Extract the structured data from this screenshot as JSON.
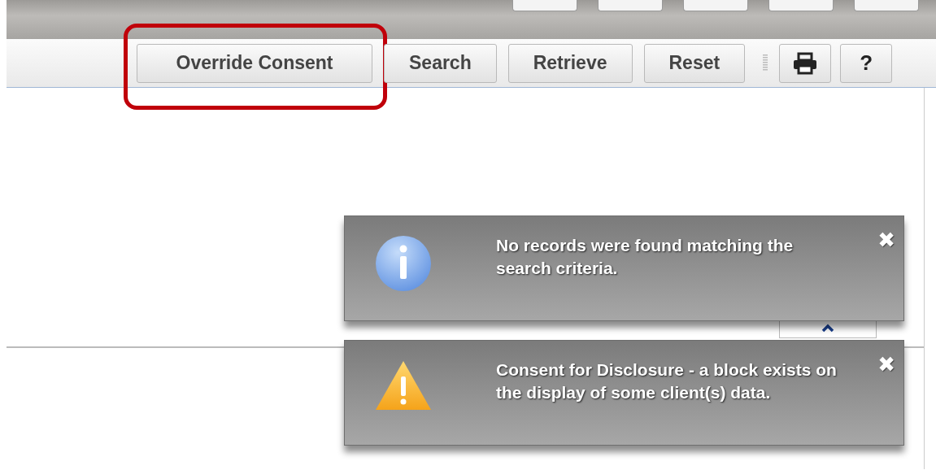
{
  "top_tabs": [
    {
      "kind": "button"
    },
    {
      "kind": "button"
    },
    {
      "kind": "button"
    },
    {
      "kind": "button"
    },
    {
      "kind": "button"
    }
  ],
  "toolbar": {
    "buttons": [
      {
        "kind": "text",
        "label": "Override Consent",
        "highlighted": true
      },
      {
        "kind": "text",
        "label": "Search",
        "highlighted": false
      },
      {
        "kind": "text",
        "label": "Retrieve",
        "highlighted": false
      },
      {
        "kind": "text",
        "label": "Reset",
        "highlighted": false
      },
      {
        "kind": "separator"
      },
      {
        "kind": "print"
      },
      {
        "kind": "text-icon",
        "label": "?",
        "highlighted": false
      }
    ]
  },
  "notifications": [
    {
      "kind": "info",
      "message": "No records were found matching the search criteria.",
      "close": "✖"
    },
    {
      "kind": "warning",
      "message": "Consent for Disclosure - a block exists on the display of some client(s) data.",
      "close": "✖"
    }
  ]
}
